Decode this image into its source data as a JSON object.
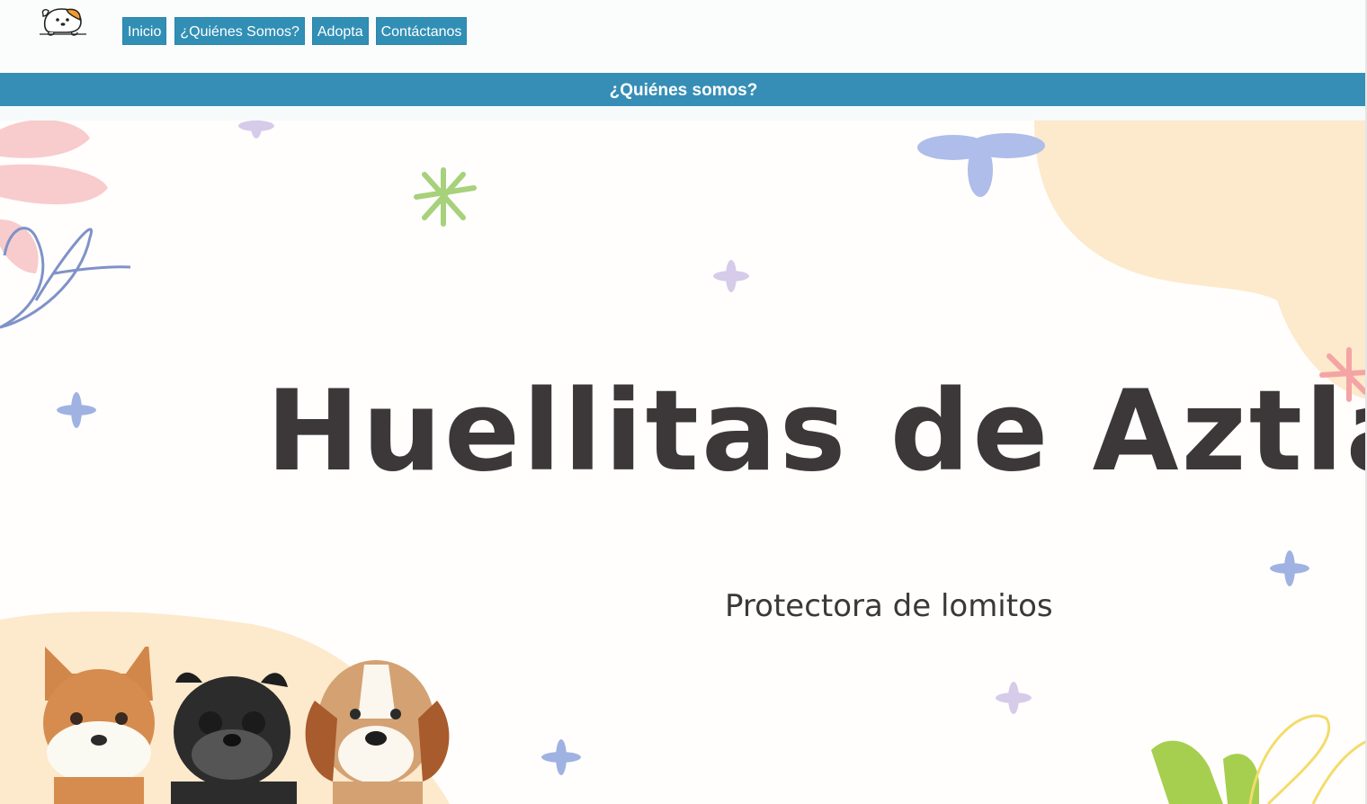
{
  "header": {
    "logo_icon": "puppy-logo-icon",
    "nav": [
      {
        "label": "Inicio"
      },
      {
        "label": "¿Quiénes Somos?"
      },
      {
        "label": "Adopta"
      },
      {
        "label": "Contáctanos"
      }
    ]
  },
  "section": {
    "title": "¿Quiénes somos?"
  },
  "hero": {
    "title": "Huellitas de Aztlán",
    "subtitle": "Protectora de lomitos"
  },
  "colors": {
    "nav_button": "#318fb5",
    "section_bar": "#368eb6",
    "title_text": "#3c3839",
    "peach_blob": "#fde9cc",
    "pink_flower": "#f7c9c9",
    "blue_flower": "#aab8e6",
    "green_star": "#a6d27a"
  }
}
